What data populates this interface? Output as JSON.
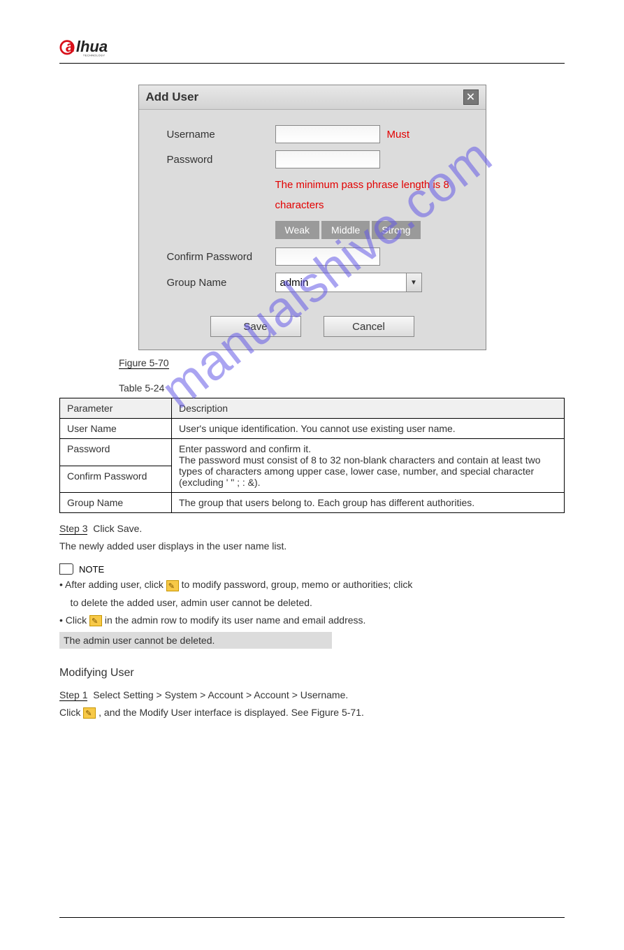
{
  "logo": {
    "brand": "alhua",
    "sub": "TECHNOLOGY"
  },
  "dialog": {
    "title": "Add User",
    "close_aria": "close",
    "username_label": "Username",
    "username_value": "",
    "username_hint": "Must",
    "password_label": "Password",
    "password_value": "",
    "password_hint": "The minimum pass phrase length is 8 characters",
    "strength": [
      "Weak",
      "Middle",
      "Strong"
    ],
    "confirm_label": "Confirm Password",
    "confirm_value": "",
    "group_label": "Group Name",
    "group_value": "admin",
    "save_label": "Save",
    "cancel_label": "Cancel"
  },
  "captions": {
    "figure": "Figure 5-70",
    "table": "Table 5-24"
  },
  "table": {
    "headers": [
      "Parameter",
      "Description"
    ],
    "rows": [
      {
        "param": "User Name",
        "desc": "User's unique identification. You cannot use existing user name."
      },
      {
        "param": "Password",
        "desc_combined_top": "Enter password and confirm it.",
        "desc_combined_bottom": "The password must consist of 8 to 32 non-blank characters and contain at least two types of characters among upper case, lower case, number, and special character (excluding ' \" ; : &)."
      },
      {
        "param": "Confirm Password"
      },
      {
        "param": "Group Name",
        "desc": "The group that users belong to. Each group has different authorities."
      }
    ]
  },
  "steps": {
    "step3_label": "Step 3",
    "step3_text": "Click Save.",
    "step3_after": "The newly added user displays in the user name list.",
    "note_label": "NOTE",
    "note_text": "After adding user, click ",
    "note_text2": " to modify password, group, memo or authorities; click ",
    "note_text3": " to delete the added user, admin user cannot be deleted.",
    "note_text4": "Click ",
    "note_text5": " in the admin row to modify its user name and email address.",
    "modify_icon_name": "modify-icon",
    "delete_icon_name": "delete-icon"
  },
  "heading": "Modifying User",
  "modify_steps": {
    "step1_label": "Step 1",
    "step1_text_a": "Select Setting > System > Account > Account > Username.",
    "step1_text_b": "Click ",
    "step1_text_c": " , and the Modify User interface is displayed. See Figure 5-71."
  },
  "highlight": "The admin user cannot be deleted.",
  "footer": {
    "left": "",
    "right": ""
  },
  "watermark": "manualshive.com"
}
